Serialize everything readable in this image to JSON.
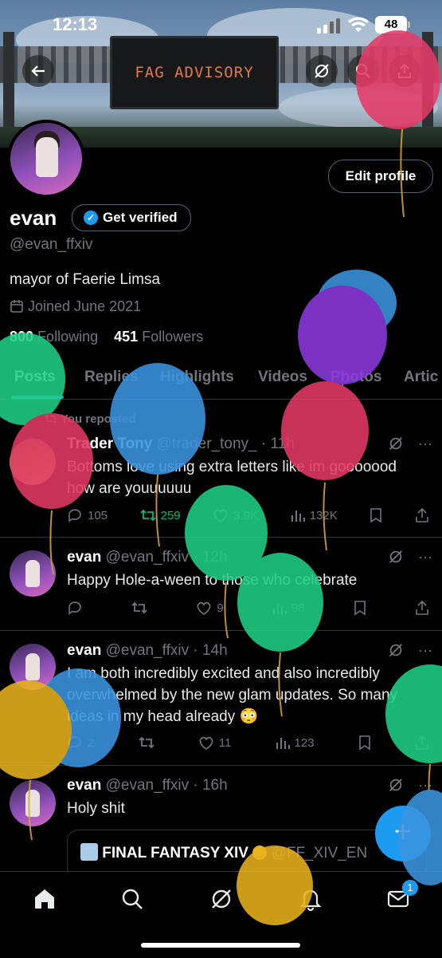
{
  "status": {
    "time": "12:13",
    "battery": "48"
  },
  "banner": {
    "sign_text": "FAG ADVISORY"
  },
  "profile": {
    "edit_label": "Edit profile",
    "name": "evan",
    "verify_label": "Get verified",
    "handle": "@evan_ffxiv",
    "bio": "mayor of Faerie Limsa",
    "joined": "Joined June 2021",
    "following_count": "800",
    "following_label": "Following",
    "followers_count": "451",
    "followers_label": "Followers"
  },
  "tabs": [
    "Posts",
    "Replies",
    "Highlights",
    "Videos",
    "Photos",
    "Artic"
  ],
  "tweets": [
    {
      "context": "You reposted",
      "author": "Trader Tony",
      "meta": "@trader_tony_ · 11h",
      "text": "Bottoms love using extra letters like im gooooood how are youuuuuu",
      "replies": "105",
      "reposts": "259",
      "likes": "3.9K",
      "views": "132K"
    },
    {
      "author": "evan",
      "meta": "@evan_ffxiv · 12h",
      "text": "Happy Hole-a-ween to those who celebrate",
      "replies": "",
      "reposts": "",
      "likes": "9",
      "views": "98"
    },
    {
      "author": "evan",
      "meta": "@evan_ffxiv · 14h",
      "text": "I am both incredibly excited and also incredibly overwhelmed by the new glam updates. So many ideas in my head already 😳",
      "replies": "2",
      "reposts": "",
      "likes": "11",
      "views": "123"
    },
    {
      "author": "evan",
      "meta": "@evan_ffxiv · 16h",
      "text": "Holy shit",
      "quote_author": "FINAL FANTASY XIV",
      "quote_handle": "@FF_XIV_EN"
    }
  ],
  "nav": {
    "messages_badge": "1"
  },
  "colors": {
    "accent": "#1d9bf0",
    "repost_green": "#00ba7c"
  },
  "icons": [
    "back-arrow-icon",
    "grok-icon",
    "search-icon",
    "share-icon",
    "calendar-icon",
    "verified-check-icon",
    "repost-icon",
    "reply-icon",
    "like-icon",
    "views-icon",
    "bookmark-icon",
    "more-icon",
    "home-icon",
    "notifications-icon",
    "messages-icon",
    "compose-icon"
  ]
}
